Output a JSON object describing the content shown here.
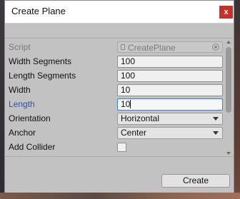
{
  "window": {
    "title": "Create Plane",
    "close_label": "x"
  },
  "fields": {
    "script": {
      "label": "Script",
      "value": "CreatePlane"
    },
    "width_segments": {
      "label": "Width Segments",
      "value": "100"
    },
    "length_segments": {
      "label": "Length Segments",
      "value": "100"
    },
    "width": {
      "label": "Width",
      "value": "10"
    },
    "length": {
      "label": "Length",
      "value": "10"
    },
    "orientation": {
      "label": "Orientation",
      "value": "Horizontal"
    },
    "anchor": {
      "label": "Anchor",
      "value": "Center"
    },
    "add_collider": {
      "label": "Add Collider",
      "checked": false
    }
  },
  "footer": {
    "create_label": "Create"
  },
  "colors": {
    "focus_border": "#3c7fd9",
    "active_label": "#2b54a4",
    "close_button": "#c6302b"
  }
}
